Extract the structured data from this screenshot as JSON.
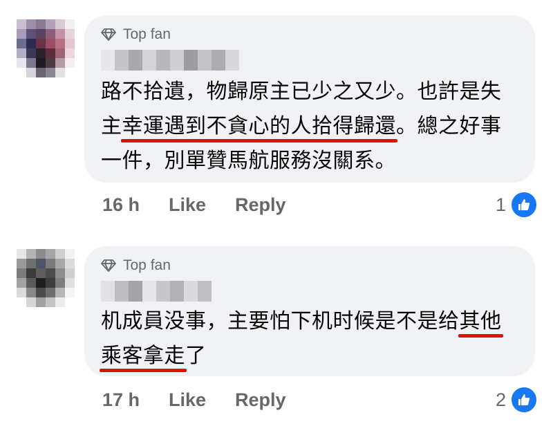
{
  "comments": [
    {
      "badge": "Top fan",
      "text_parts": [
        "路不拾遺，物歸原主已少之又少。也許是失主",
        "幸運遇到不貪心的人拾得歸還",
        "。總之好事一件，別單贊馬航服務沒關系。"
      ],
      "time": "16 h",
      "like_label": "Like",
      "reply_label": "Reply",
      "reaction_count": "1"
    },
    {
      "badge": "Top fan",
      "text_parts": [
        "机成員没事，主要怕下机时候是不是给",
        "其他",
        "乘客拿走",
        "了"
      ],
      "time": "17 h",
      "like_label": "Like",
      "reply_label": "Reply",
      "reaction_count": "2"
    }
  ],
  "colors": {
    "bubble": "#f0f2f5",
    "meta_text": "#65676b",
    "underline": "#e01010",
    "like_blue": "#1877f2"
  },
  "icons": {
    "badge": "diamond-icon",
    "reaction": "thumbs-up-icon"
  }
}
